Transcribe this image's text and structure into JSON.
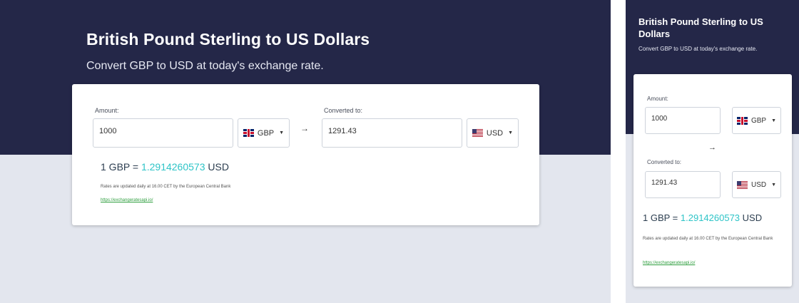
{
  "header": {
    "title": "British Pound Sterling to US Dollars",
    "subtitle": "Convert GBP to USD at today's exchange rate."
  },
  "converter": {
    "amount_label": "Amount:",
    "amount_value": "1000",
    "from_currency": "GBP",
    "arrow_glyph": "→",
    "converted_label": "Converted to:",
    "converted_value": "1291.43",
    "to_currency": "USD",
    "caret_glyph": "▼"
  },
  "rate": {
    "prefix": "1 GBP = ",
    "value": "1.2914260573",
    "suffix": " USD"
  },
  "footer": {
    "note": "Rates are updated daily at 16.00 CET by the European Central Bank",
    "link": "https://exchangeratesapi.io/"
  },
  "colors": {
    "header_bg": "#242748",
    "page_bg": "#e3e6ee",
    "rate_accent": "#2ec4c7",
    "link": "#2e9e3e"
  },
  "icons": {
    "from_flag": "uk-flag-icon",
    "to_flag": "us-flag-icon",
    "arrow": "arrow-right-icon",
    "caret": "caret-down-icon"
  }
}
